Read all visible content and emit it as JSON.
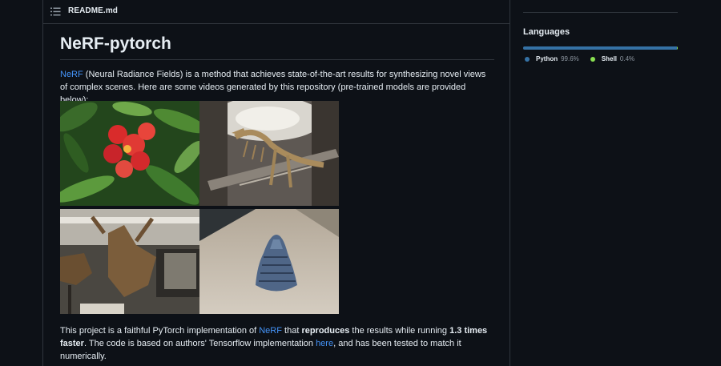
{
  "readme": {
    "filename": "README.md",
    "title": "NeRF-pytorch",
    "intro": {
      "link": "NeRF",
      "text": " (Neural Radiance Fields) is a method that achieves state-of-the-art results for synthesizing novel views of complex scenes. Here are some videos generated by this repository (pre-trained models are provided below):"
    },
    "outro": {
      "t1": "This project is a faithful PyTorch implementation of ",
      "link1": "NeRF",
      "t2": " that ",
      "b1": "reproduces",
      "t3": " the results while running ",
      "b2": "1.3 times faster",
      "t4": ". The code is based on authors' Tensorflow implementation ",
      "link2": "here",
      "t5": ", and has been tested to match it numerically."
    }
  },
  "languages": {
    "title": "Languages",
    "items": [
      {
        "name": "Python",
        "percent": "99.6%",
        "value": 99.6,
        "color": "#3572a5"
      },
      {
        "name": "Shell",
        "percent": "0.4%",
        "value": 0.4,
        "color": "#89e051"
      }
    ]
  }
}
